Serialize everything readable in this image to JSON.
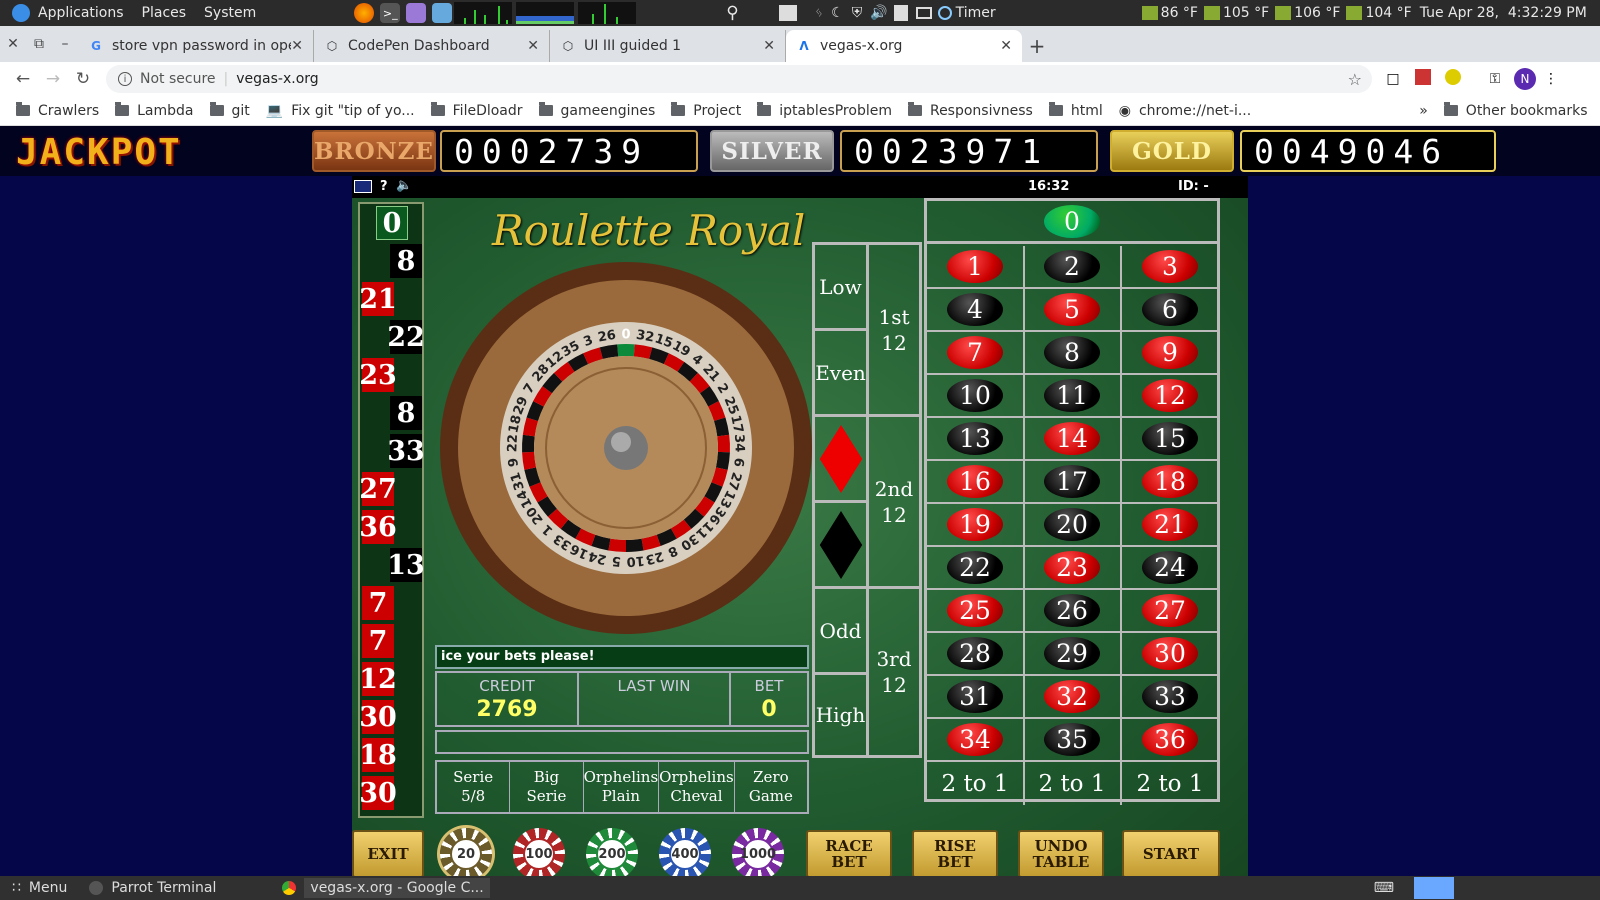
{
  "panel": {
    "applications": "Applications",
    "places": "Places",
    "system": "System",
    "timer": "Timer",
    "temps": [
      "86 °F",
      "105 °F",
      "106 °F",
      "104 °F"
    ],
    "clock": "Tue Apr 28,  4:32:29 PM"
  },
  "tabs": [
    {
      "title": "store vpn password in ope",
      "icon": "google-icon"
    },
    {
      "title": "CodePen Dashboard",
      "icon": "codepen-icon"
    },
    {
      "title": "UI III guided 1",
      "icon": "codepen-icon"
    },
    {
      "title": "vegas-x.org",
      "icon": "vegas-icon"
    }
  ],
  "address": {
    "security": "Not secure",
    "url": "vegas-x.org",
    "profile": "N"
  },
  "bookmarks": [
    {
      "label": "Crawlers",
      "icon": "folder-icon"
    },
    {
      "label": "Lambda",
      "icon": "folder-icon"
    },
    {
      "label": "git",
      "icon": "folder-icon"
    },
    {
      "label": "Fix git \"tip of yo...",
      "icon": "laptop-icon"
    },
    {
      "label": "FileDloadr",
      "icon": "folder-icon"
    },
    {
      "label": "gameengines",
      "icon": "folder-icon"
    },
    {
      "label": "Project",
      "icon": "folder-icon"
    },
    {
      "label": "iptablesProblem",
      "icon": "folder-icon"
    },
    {
      "label": "Responsivness",
      "icon": "folder-icon"
    },
    {
      "label": "html",
      "icon": "folder-icon"
    },
    {
      "label": "chrome://net-i...",
      "icon": "chrome-icon"
    }
  ],
  "bookmarks_more": "»",
  "bookmarks_other": "Other bookmarks",
  "jackpot": {
    "word": "JACKPOT",
    "bronze_label": "BRONZE",
    "bronze_value": "0002739",
    "silver_label": "SILVER",
    "silver_value": "0023971",
    "gold_label": "GOLD",
    "gold_value": "0049046"
  },
  "game_bar": {
    "help": "?",
    "time": "16:32",
    "id": "ID: -"
  },
  "game_title": "Roulette Royal",
  "history": [
    {
      "n": "0",
      "c": "g"
    },
    {
      "n": "8",
      "c": "b"
    },
    {
      "n": "21",
      "c": "r"
    },
    {
      "n": "22",
      "c": "b"
    },
    {
      "n": "23",
      "c": "r"
    },
    {
      "n": "8",
      "c": "b"
    },
    {
      "n": "33",
      "c": "b"
    },
    {
      "n": "27",
      "c": "r"
    },
    {
      "n": "36",
      "c": "r"
    },
    {
      "n": "13",
      "c": "b"
    },
    {
      "n": "7",
      "c": "r"
    },
    {
      "n": "7",
      "c": "r"
    },
    {
      "n": "12",
      "c": "r"
    },
    {
      "n": "30",
      "c": "r"
    },
    {
      "n": "18",
      "c": "r"
    },
    {
      "n": "30",
      "c": "r"
    }
  ],
  "wheel_numbers": [
    "0",
    "32",
    "15",
    "19",
    "4",
    "21",
    "2",
    "25",
    "17",
    "34",
    "6",
    "27",
    "13",
    "36",
    "11",
    "30",
    "8",
    "23",
    "10",
    "5",
    "24",
    "16",
    "33",
    "1",
    "20",
    "14",
    "31",
    "9",
    "22",
    "18",
    "29",
    "7",
    "28",
    "12",
    "35",
    "3",
    "26"
  ],
  "message": "ice your bets please!",
  "stats": {
    "credit_label": "CREDIT",
    "credit": "2769",
    "lastwin_label": "LAST WIN",
    "lastwin": "",
    "bet_label": "BET",
    "bet": "0"
  },
  "racetrack": [
    {
      "l1": "Serie",
      "l2": "5/8"
    },
    {
      "l1": "Big",
      "l2": "Serie"
    },
    {
      "l1": "Orphelins",
      "l2": "Plain"
    },
    {
      "l1": "Orphelins",
      "l2": "Cheval"
    },
    {
      "l1": "Zero",
      "l2": "Game"
    }
  ],
  "outside": {
    "low": "Low",
    "even": "Even",
    "odd": "Odd",
    "high": "High",
    "d1a": "1st",
    "d1b": "12",
    "d2a": "2nd",
    "d2b": "12",
    "d3a": "3rd",
    "d3b": "12"
  },
  "table_numbers": [
    [
      "1",
      "r"
    ],
    [
      "2",
      "b"
    ],
    [
      "3",
      "r"
    ],
    [
      "4",
      "b"
    ],
    [
      "5",
      "r"
    ],
    [
      "6",
      "b"
    ],
    [
      "7",
      "r"
    ],
    [
      "8",
      "b"
    ],
    [
      "9",
      "r"
    ],
    [
      "10",
      "b"
    ],
    [
      "11",
      "b"
    ],
    [
      "12",
      "r"
    ],
    [
      "13",
      "b"
    ],
    [
      "14",
      "r"
    ],
    [
      "15",
      "b"
    ],
    [
      "16",
      "r"
    ],
    [
      "17",
      "b"
    ],
    [
      "18",
      "r"
    ],
    [
      "19",
      "r"
    ],
    [
      "20",
      "b"
    ],
    [
      "21",
      "r"
    ],
    [
      "22",
      "b"
    ],
    [
      "23",
      "r"
    ],
    [
      "24",
      "b"
    ],
    [
      "25",
      "r"
    ],
    [
      "26",
      "b"
    ],
    [
      "27",
      "r"
    ],
    [
      "28",
      "b"
    ],
    [
      "29",
      "b"
    ],
    [
      "30",
      "r"
    ],
    [
      "31",
      "b"
    ],
    [
      "32",
      "r"
    ],
    [
      "33",
      "b"
    ],
    [
      "34",
      "r"
    ],
    [
      "35",
      "b"
    ],
    [
      "36",
      "r"
    ]
  ],
  "zero": "0",
  "two_to_one": [
    "2 to 1",
    "2 to 1",
    "2 to 1"
  ],
  "buttons": {
    "exit": "EXIT",
    "race_bet": "RACE BET",
    "rise_bet": "RISE BET",
    "undo_table": "UNDO TABLE",
    "start": "START"
  },
  "chips": [
    {
      "v": "20",
      "color": "#6b5a2a"
    },
    {
      "v": "100",
      "color": "#b02525"
    },
    {
      "v": "200",
      "color": "#1e8a3a"
    },
    {
      "v": "400",
      "color": "#2a55b0"
    },
    {
      "v": "1000",
      "color": "#7a2aa0"
    }
  ],
  "taskbar": {
    "menu": "Menu",
    "terminal": "Parrot Terminal",
    "chrome": "vegas-x.org - Google C..."
  }
}
